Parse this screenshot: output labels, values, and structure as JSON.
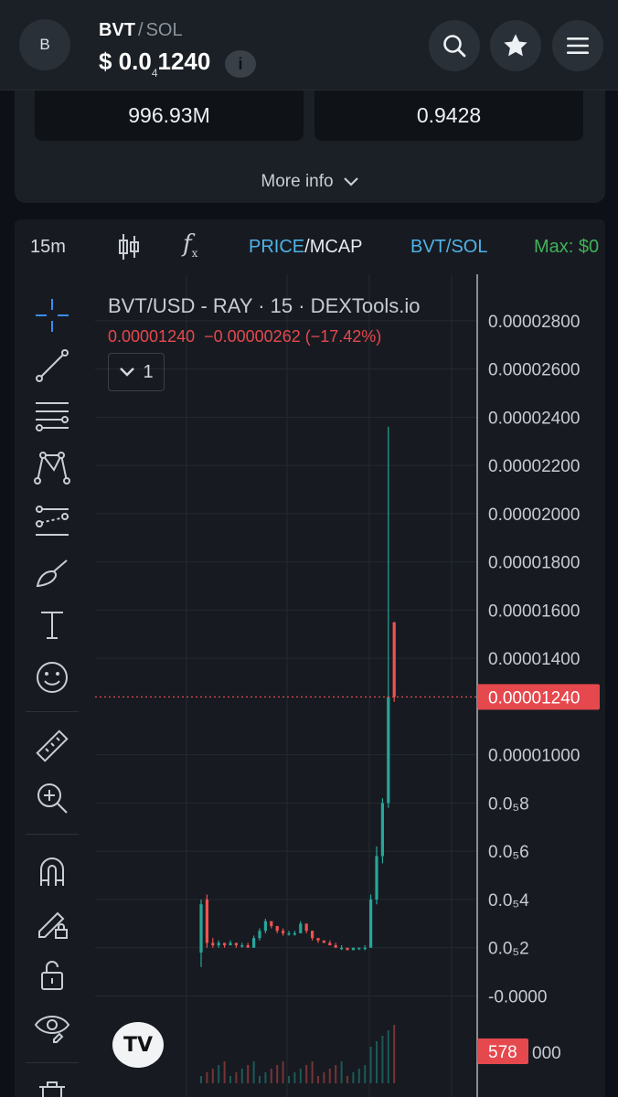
{
  "header": {
    "avatar_letter": "B",
    "base_symbol": "BVT",
    "separator": "/",
    "quote_symbol": "SOL",
    "price_prefix": "$ 0.0",
    "price_zeros": "4",
    "price_digits": "1240",
    "info_icon": "i",
    "buttons": [
      "search-icon",
      "star-icon",
      "menu-icon"
    ]
  },
  "stats": {
    "left_value": "996.93M",
    "right_value": "0.9428",
    "more_info_label": "More info"
  },
  "chart_toolbar": {
    "timeframe": "15m",
    "fx_label": "f",
    "fx_sub": "x",
    "price_label": "PRICE",
    "price_sep": "/",
    "mcap_label": "MCAP",
    "pair_label": "BVT/SOL",
    "max_label": "Max: $0"
  },
  "legend": {
    "title": "BVT/USD - RAY · 15 · DEXTools.io",
    "values": "0.00001240  −0.00000262 (−17.42%)",
    "collapse_count": "1"
  },
  "tv_logo_text": "TV",
  "colors": {
    "up": "#26a69a",
    "down": "#ef5350",
    "accent_blue": "#4fb3e8",
    "accent_green": "#41b05a",
    "price_tag": "#e5484d"
  },
  "chart_data": {
    "type": "candlestick",
    "symbol": "BVT/USD",
    "interval": "15",
    "ylim": [
      -4e-07,
      2.86e-05
    ],
    "y_tick_labels": [
      {
        "value": 2.8e-05,
        "label": "0.00002800"
      },
      {
        "value": 2.6e-05,
        "label": "0.00002600"
      },
      {
        "value": 2.4e-05,
        "label": "0.00002400"
      },
      {
        "value": 2.2e-05,
        "label": "0.00002200"
      },
      {
        "value": 2e-05,
        "label": "0.00002000"
      },
      {
        "value": 1.8e-05,
        "label": "0.00001800"
      },
      {
        "value": 1.6e-05,
        "label": "0.00001600"
      },
      {
        "value": 1.4e-05,
        "label": "0.00001400"
      },
      {
        "value": 1e-05,
        "label": "0.00001000"
      },
      {
        "value": 8e-06,
        "label": "0.0₅8"
      },
      {
        "value": 6e-06,
        "label": "0.0₅6"
      },
      {
        "value": 4e-06,
        "label": "0.0₅4"
      },
      {
        "value": 2e-06,
        "label": "0.0₅2"
      },
      {
        "value": 0.0,
        "label": "-0.0000"
      }
    ],
    "last_price": 1.24e-05,
    "last_price_label": "0.00001240",
    "volume_label": "578",
    "volume_axis_fragment": "000",
    "candles": [
      {
        "t": 0,
        "o": 1.8e-06,
        "h": 4e-06,
        "l": 1.2e-06,
        "c": 3.8e-06
      },
      {
        "t": 1,
        "o": 4e-06,
        "h": 4.2e-06,
        "l": 2e-06,
        "c": 2.2e-06
      },
      {
        "t": 2,
        "o": 2.2e-06,
        "h": 2.4e-06,
        "l": 2e-06,
        "c": 2.1e-06
      },
      {
        "t": 3,
        "o": 2.1e-06,
        "h": 2.3e-06,
        "l": 2e-06,
        "c": 2.2e-06
      },
      {
        "t": 4,
        "o": 2.2e-06,
        "h": 2.2e-06,
        "l": 2e-06,
        "c": 2.1e-06
      },
      {
        "t": 5,
        "o": 2.1e-06,
        "h": 2.3e-06,
        "l": 2.1e-06,
        "c": 2.2e-06
      },
      {
        "t": 6,
        "o": 2.2e-06,
        "h": 2.2e-06,
        "l": 2e-06,
        "c": 2.1e-06
      },
      {
        "t": 7,
        "o": 2.1e-06,
        "h": 2.2e-06,
        "l": 2e-06,
        "c": 2.1e-06
      },
      {
        "t": 8,
        "o": 2.1e-06,
        "h": 2.2e-06,
        "l": 2e-06,
        "c": 2e-06
      },
      {
        "t": 9,
        "o": 2e-06,
        "h": 2.5e-06,
        "l": 2e-06,
        "c": 2.4e-06
      },
      {
        "t": 10,
        "o": 2.4e-06,
        "h": 2.8e-06,
        "l": 2.3e-06,
        "c": 2.7e-06
      },
      {
        "t": 11,
        "o": 2.7e-06,
        "h": 3.2e-06,
        "l": 2.6e-06,
        "c": 3.1e-06
      },
      {
        "t": 12,
        "o": 3.1e-06,
        "h": 3.1e-06,
        "l": 2.8e-06,
        "c": 2.9e-06
      },
      {
        "t": 13,
        "o": 2.9e-06,
        "h": 2.9e-06,
        "l": 2.6e-06,
        "c": 2.7e-06
      },
      {
        "t": 14,
        "o": 2.7e-06,
        "h": 2.8e-06,
        "l": 2.5e-06,
        "c": 2.6e-06
      },
      {
        "t": 15,
        "o": 2.6e-06,
        "h": 2.7e-06,
        "l": 2.5e-06,
        "c": 2.6e-06
      },
      {
        "t": 16,
        "o": 2.6e-06,
        "h": 2.7e-06,
        "l": 2.5e-06,
        "c": 2.6e-06
      },
      {
        "t": 17,
        "o": 2.6e-06,
        "h": 3.1e-06,
        "l": 2.6e-06,
        "c": 3e-06
      },
      {
        "t": 18,
        "o": 3e-06,
        "h": 3e-06,
        "l": 2.6e-06,
        "c": 2.7e-06
      },
      {
        "t": 19,
        "o": 2.7e-06,
        "h": 2.7e-06,
        "l": 2.3e-06,
        "c": 2.4e-06
      },
      {
        "t": 20,
        "o": 2.4e-06,
        "h": 2.4e-06,
        "l": 2.2e-06,
        "c": 2.3e-06
      },
      {
        "t": 21,
        "o": 2.3e-06,
        "h": 2.3e-06,
        "l": 2.2e-06,
        "c": 2.2e-06
      },
      {
        "t": 22,
        "o": 2.2e-06,
        "h": 2.3e-06,
        "l": 2.1e-06,
        "c": 2.1e-06
      },
      {
        "t": 23,
        "o": 2.1e-06,
        "h": 2.2e-06,
        "l": 2e-06,
        "c": 2e-06
      },
      {
        "t": 24,
        "o": 2e-06,
        "h": 2.1e-06,
        "l": 1.9e-06,
        "c": 2e-06
      },
      {
        "t": 25,
        "o": 2e-06,
        "h": 2e-06,
        "l": 1.9e-06,
        "c": 1.9e-06
      },
      {
        "t": 26,
        "o": 1.9e-06,
        "h": 2e-06,
        "l": 1.9e-06,
        "c": 2e-06
      },
      {
        "t": 27,
        "o": 2e-06,
        "h": 2e-06,
        "l": 1.9e-06,
        "c": 2e-06
      },
      {
        "t": 28,
        "o": 2e-06,
        "h": 2.1e-06,
        "l": 1.9e-06,
        "c": 2e-06
      },
      {
        "t": 29,
        "o": 2e-06,
        "h": 4.2e-06,
        "l": 2e-06,
        "c": 4e-06
      },
      {
        "t": 30,
        "o": 4e-06,
        "h": 6.2e-06,
        "l": 3.8e-06,
        "c": 5.8e-06
      },
      {
        "t": 31,
        "o": 5.8e-06,
        "h": 8.2e-06,
        "l": 5.5e-06,
        "c": 8e-06
      },
      {
        "t": 32,
        "o": 8e-06,
        "h": 2.36e-05,
        "l": 7.8e-06,
        "c": 1.24e-05
      },
      {
        "t": 33,
        "o": 1.55e-05,
        "h": 1.55e-05,
        "l": 1.22e-05,
        "c": 1.24e-05
      }
    ]
  }
}
